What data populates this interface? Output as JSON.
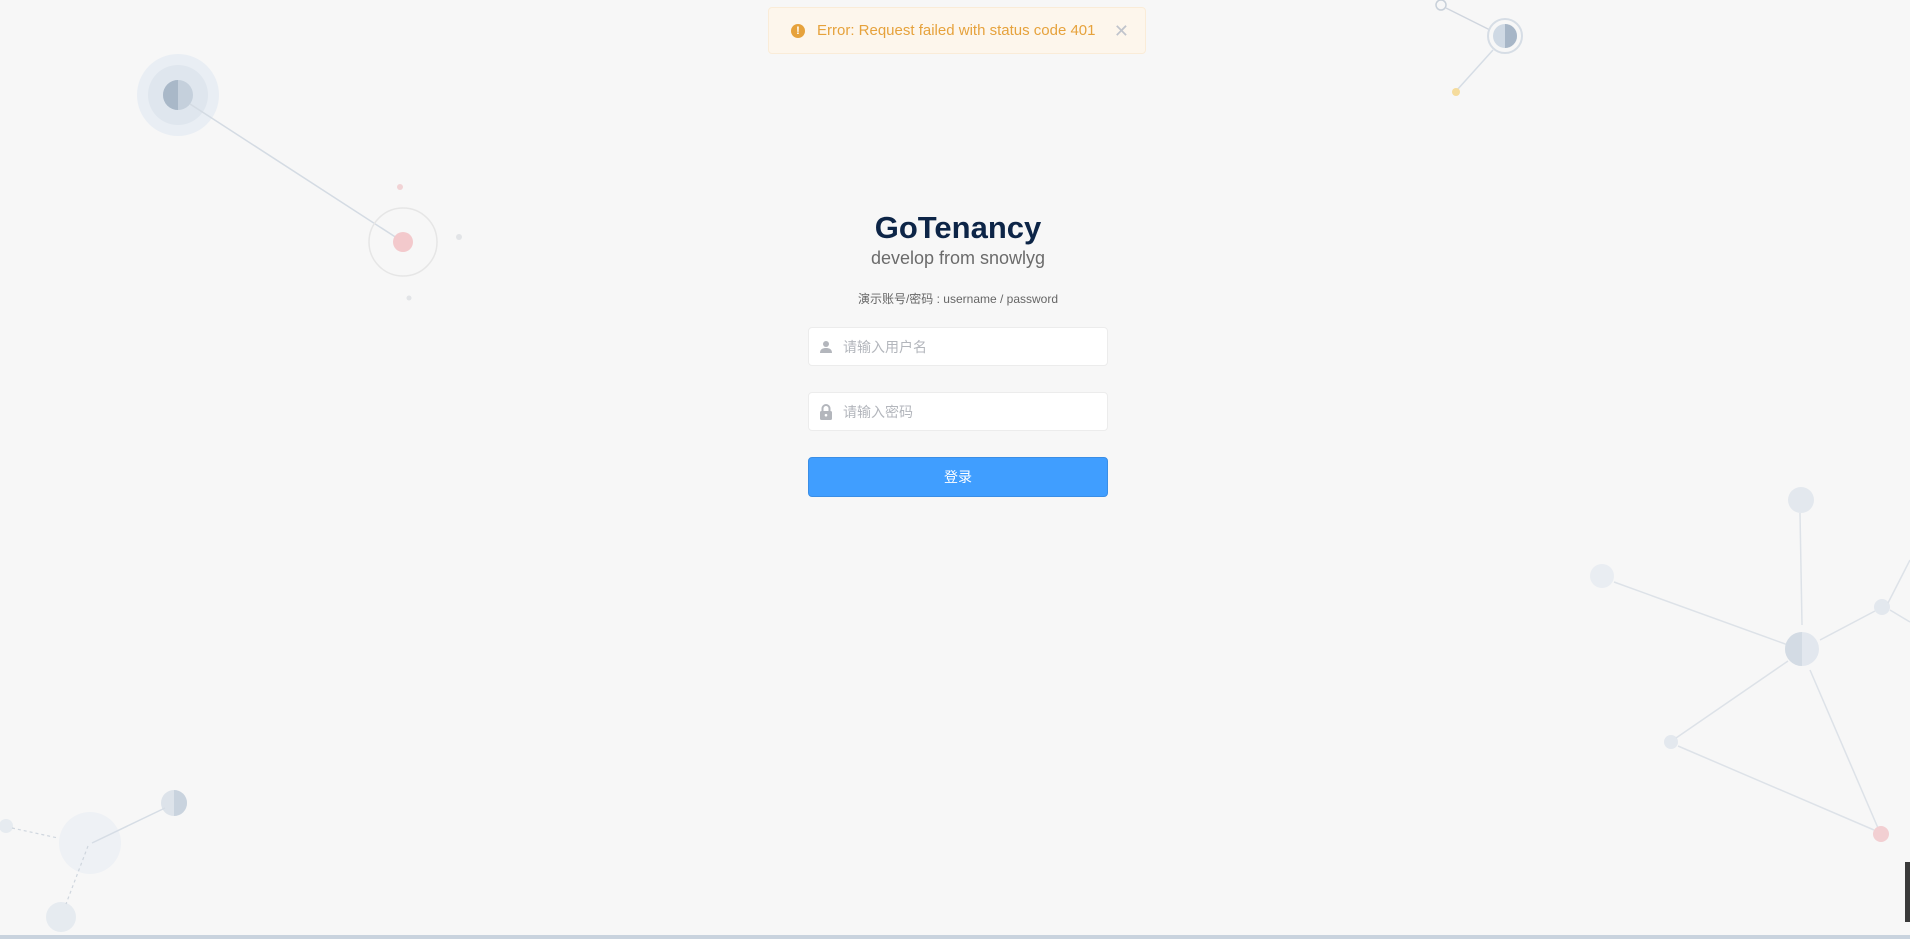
{
  "notification": {
    "type": "warning",
    "icon": "warning-circle-icon",
    "message": "Error: Request failed with status code 401",
    "close_icon": "close-icon",
    "color": "#e6a23c"
  },
  "login": {
    "title": "GoTenancy",
    "subtitle": "develop from snowlyg",
    "demo_hint": "演示账号/密码 : username / password",
    "username": {
      "icon": "user-icon",
      "placeholder": "请输入用户名",
      "value": ""
    },
    "password": {
      "icon": "lock-icon",
      "placeholder": "请输入密码",
      "value": ""
    },
    "submit_label": "登录",
    "accent_color": "#409eff"
  }
}
